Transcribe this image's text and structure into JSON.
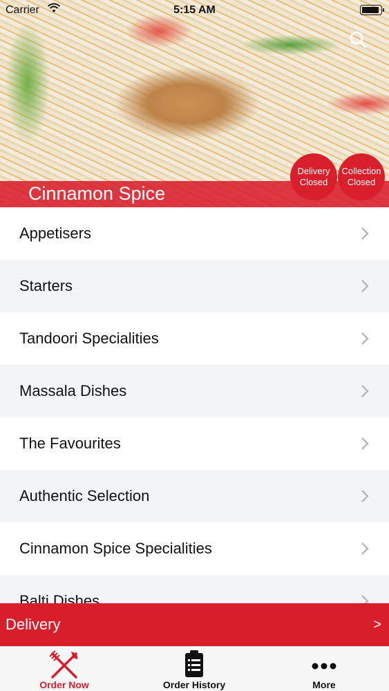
{
  "status_bar": {
    "carrier": "Carrier",
    "time": "5:15 AM"
  },
  "hero": {
    "restaurant_name": "Cinnamon Spice",
    "delivery_status": {
      "line1": "Delivery",
      "line2": "Closed"
    },
    "collection_status": {
      "line1": "Collection",
      "line2": "Closed"
    }
  },
  "menu": {
    "items": [
      {
        "label": "Appetisers"
      },
      {
        "label": "Starters"
      },
      {
        "label": "Tandoori Specialities"
      },
      {
        "label": "Massala Dishes"
      },
      {
        "label": "The Favourites"
      },
      {
        "label": "Authentic Selection"
      },
      {
        "label": "Cinnamon Spice Specialities"
      },
      {
        "label": "Balti Dishes"
      }
    ]
  },
  "delivery_bar": {
    "label": "Delivery",
    "arrow": ">"
  },
  "tabs": [
    {
      "label": "Order Now",
      "icon": "fork-knife-icon",
      "active": true
    },
    {
      "label": "Order History",
      "icon": "clipboard-list-icon",
      "active": false
    },
    {
      "label": "More",
      "icon": "more-dots-icon",
      "active": false
    }
  ],
  "colors": {
    "accent": "#d81e2b",
    "row_alt": "#f3f4f6",
    "tab_bar": "#f7f7f7"
  }
}
